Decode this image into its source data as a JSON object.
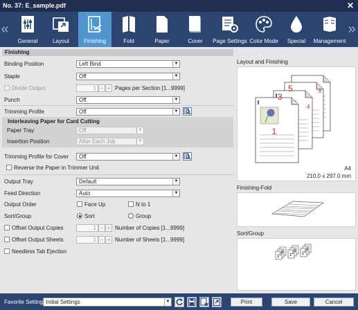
{
  "window": {
    "title": "No. 37: E_sample.pdf",
    "close_icon": "close-icon"
  },
  "tabs": [
    {
      "label": "General",
      "icon": "general-icon"
    },
    {
      "label": "Layout",
      "icon": "layout-icon"
    },
    {
      "label": "Finishing",
      "icon": "finishing-icon",
      "active": true
    },
    {
      "label": "Fold",
      "icon": "fold-icon"
    },
    {
      "label": "Paper",
      "icon": "paper-icon"
    },
    {
      "label": "Cover",
      "icon": "cover-icon"
    },
    {
      "label": "Page Settings",
      "icon": "page-settings-icon"
    },
    {
      "label": "Color Mode",
      "icon": "color-mode-icon"
    },
    {
      "label": "Special",
      "icon": "special-icon"
    },
    {
      "label": "Management",
      "icon": "management-icon"
    }
  ],
  "section_title": "Finishing",
  "binding_position": {
    "label": "Binding Position",
    "value": "Left Bind"
  },
  "staple": {
    "label": "Staple",
    "value": "Off"
  },
  "divide_output": {
    "label": "Divide Output",
    "value": "1",
    "suffix": "Pages per Section [1...9999]"
  },
  "punch": {
    "label": "Punch",
    "value": "Off"
  },
  "trimming_profile": {
    "label": "Trimming Profile",
    "value": "Off"
  },
  "interleaving": {
    "title": "Interleaving Paper for Card Cutting",
    "paper_tray_label": "Paper Tray",
    "paper_tray_value": "Off",
    "insertion_label": "Insertion Position",
    "insertion_value": "After Each Job"
  },
  "trimming_profile_cover": {
    "label": "Trimming Profile for Cover",
    "value": "Off"
  },
  "reverse_paper": {
    "label": "Reverse the Paper in Trimmer Unit"
  },
  "output_tray": {
    "label": "Output Tray",
    "value": "Default"
  },
  "feed_direction": {
    "label": "Feed Direction",
    "value": "Auto"
  },
  "output_order": {
    "label": "Output Order",
    "face_up": "Face Up",
    "n_to_1": "N to 1"
  },
  "sort_group": {
    "label": "Sort/Group",
    "sort": "Sort",
    "group": "Group",
    "selected": "Sort"
  },
  "offset_copies": {
    "label": "Offset Output Copies",
    "value": "1",
    "suffix": "Number of Copies [1...9999]"
  },
  "offset_sheets": {
    "label": "Offset Output Sheets",
    "value": "1",
    "suffix": "Number of Sheets [1...9999]"
  },
  "needless_tab": {
    "label": "Needless Tab Ejection"
  },
  "preview": {
    "layout_title": "Layout and Finishing",
    "paper_size": "A4",
    "paper_dims": "210.0 x 297.0 mm",
    "fold_title": "Finishing-Fold",
    "sort_title": "Sort/Group",
    "page_numbers": [
      "1",
      "3",
      "4",
      "5",
      "6"
    ],
    "sort_stack_numbers": [
      "1",
      "2",
      "3"
    ]
  },
  "footer": {
    "favorite_label": "Favorite Setting",
    "favorite_value": "Initial Settings",
    "print": "Print",
    "save": "Save",
    "cancel": "Cancel"
  },
  "colors": {
    "toolbar": "#2b4470",
    "title_bar": "#1e2e4c",
    "active_tab": "#4f96cf",
    "panel": "#e6e6e6"
  }
}
